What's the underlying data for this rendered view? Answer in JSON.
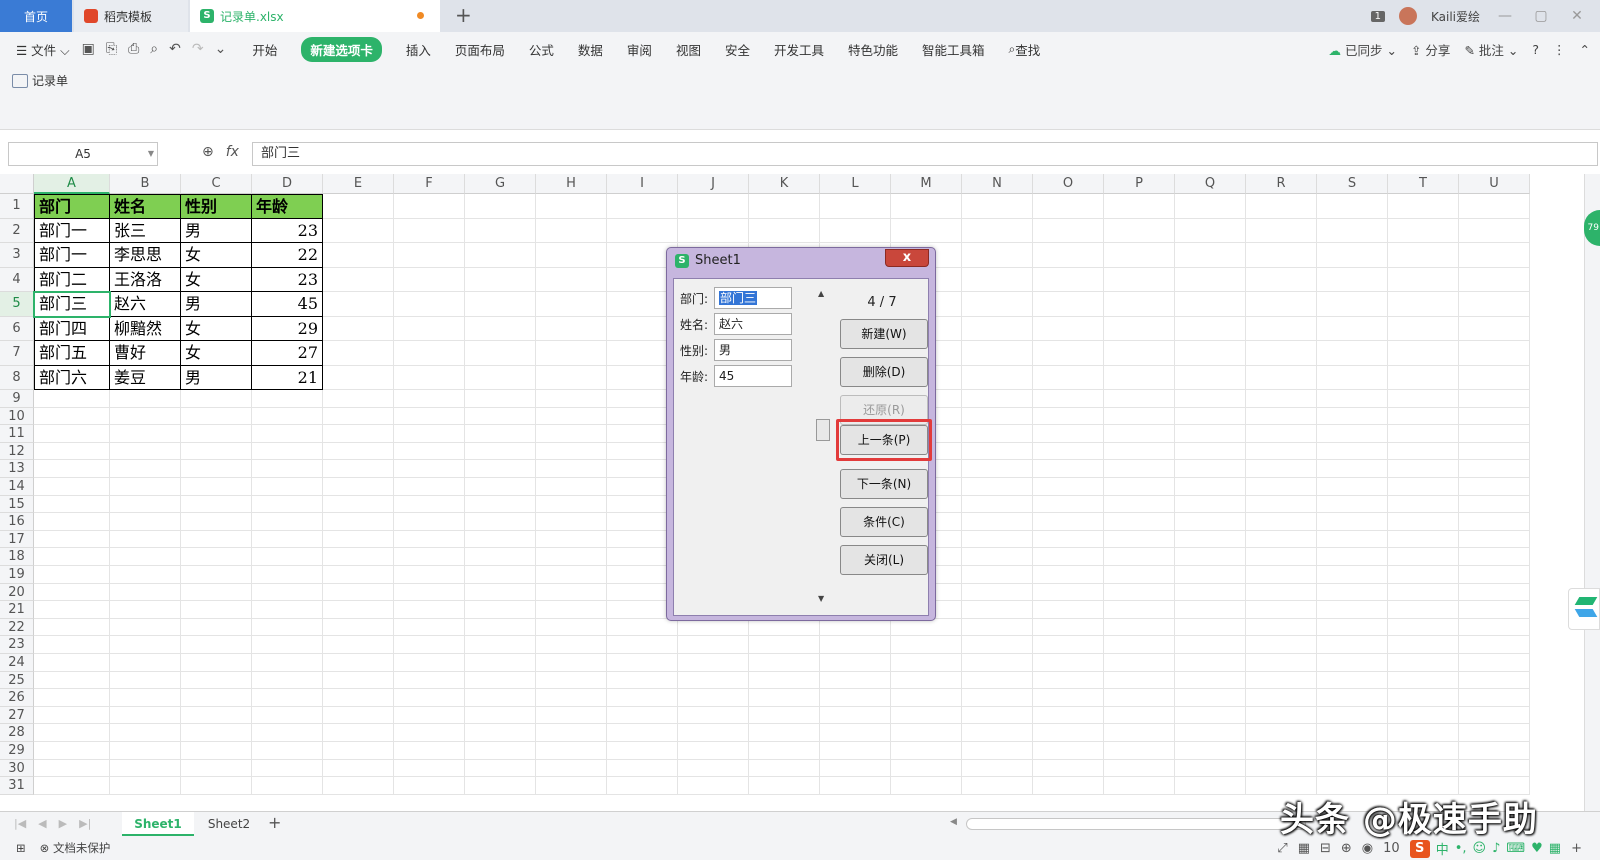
{
  "tabs": {
    "home": "首页",
    "template": "稻壳模板",
    "file": "记录单.xlsx",
    "add": "+"
  },
  "window": {
    "badge": "1",
    "user": "Kaili爱绘",
    "min": "—",
    "max": "▢",
    "close": "✕"
  },
  "menu": {
    "file": "☰ 文件 ⌵",
    "items": [
      "开始",
      "新建选项卡",
      "插入",
      "页面布局",
      "公式",
      "数据",
      "审阅",
      "视图",
      "安全",
      "开发工具",
      "特色功能",
      "智能工具箱",
      "查找"
    ],
    "active_index": 1,
    "synced": "已同步",
    "share": "分享",
    "comment": "批注"
  },
  "ribbon": {
    "form_label": "记录单"
  },
  "formula_bar": {
    "cell_ref": "A5",
    "fx": "fx",
    "content": "部门三"
  },
  "sheet": {
    "columns": [
      "A",
      "B",
      "C",
      "D",
      "E",
      "F",
      "G",
      "H",
      "I",
      "J",
      "K",
      "L",
      "M",
      "N",
      "O",
      "P",
      "Q",
      "R",
      "S",
      "T",
      "U"
    ],
    "rows": [
      "1",
      "2",
      "3",
      "4",
      "5",
      "6",
      "7",
      "8",
      "9",
      "10",
      "11",
      "12",
      "13",
      "14",
      "15",
      "16",
      "17",
      "18",
      "19",
      "20",
      "21",
      "22",
      "23",
      "24",
      "25",
      "26",
      "27",
      "28",
      "29",
      "30",
      "31"
    ],
    "header": [
      "部门",
      "姓名",
      "性别",
      "年龄"
    ],
    "data": [
      [
        "部门一",
        "张三",
        "男",
        "23"
      ],
      [
        "部门一",
        "李思思",
        "女",
        "22"
      ],
      [
        "部门二",
        "王洛洛",
        "女",
        "23"
      ],
      [
        "部门三",
        "赵六",
        "男",
        "45"
      ],
      [
        "部门四",
        "柳黯然",
        "女",
        "29"
      ],
      [
        "部门五",
        "曹好",
        "女",
        "27"
      ],
      [
        "部门六",
        "姜豆",
        "男",
        "21"
      ]
    ],
    "active_cell": "A5",
    "header_color": "#7fcf52"
  },
  "sheet_tabs": {
    "tabs": [
      "Sheet1",
      "Sheet2"
    ],
    "active": "Sheet1",
    "add": "+"
  },
  "status": {
    "protect": "文档未保护",
    "zoom": "10"
  },
  "floating": {
    "green_badge": "79"
  },
  "dialog": {
    "title": "Sheet1",
    "close": "x",
    "fields": [
      {
        "label": "部门:",
        "value": "部门三"
      },
      {
        "label": "姓名:",
        "value": "赵六"
      },
      {
        "label": "性别:",
        "value": "男"
      },
      {
        "label": "年龄:",
        "value": "45"
      }
    ],
    "counter": "4 / 7",
    "buttons": {
      "new": "新建(W)",
      "delete": "删除(D)",
      "restore": "还原(R)",
      "prev": "上一条(P)",
      "next": "下一条(N)",
      "criteria": "条件(C)",
      "close": "关闭(L)"
    }
  },
  "watermark": "头条 @极速手助",
  "colors": {
    "accent_green": "#2db36a",
    "highlight_red": "#e23b3b",
    "tab_blue": "#3a7bd5"
  }
}
